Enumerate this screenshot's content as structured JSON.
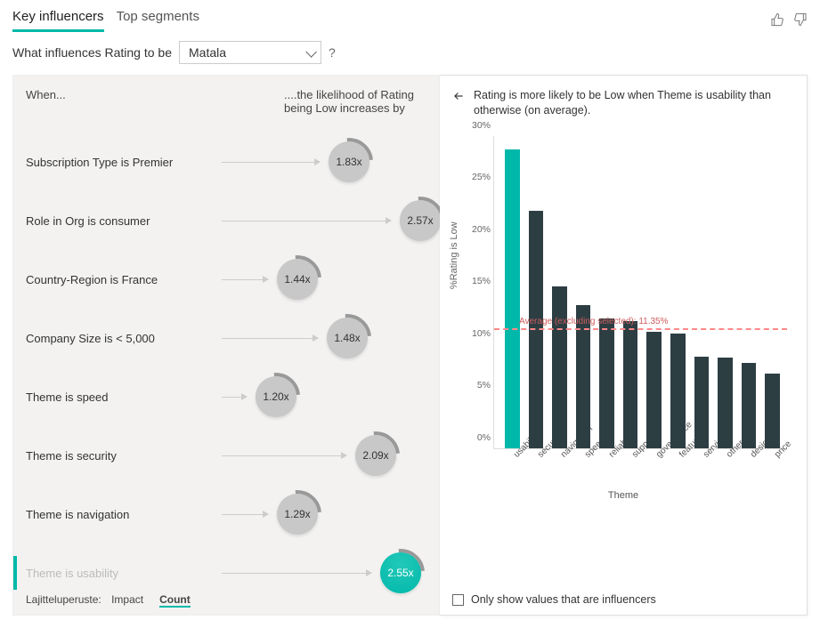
{
  "tabs": {
    "key_influencers": "Key influencers",
    "top_segments": "Top segments"
  },
  "question": {
    "prefix": "What influences Rating to be",
    "value": "Matala",
    "help": "?"
  },
  "left": {
    "when": "When...",
    "likelihood": "....the likelihood of Rating being Low increases by",
    "sort_label": "Lajitteluperuste:",
    "sort_impact": "Impact",
    "sort_count": "Count",
    "influencers": [
      {
        "label": "Subscription Type is Premier",
        "value": "1.83x",
        "pos": 120,
        "selected": false
      },
      {
        "label": "Role in Org is consumer",
        "value": "2.57x",
        "pos": 200,
        "selected": false
      },
      {
        "label": "Country-Region is France",
        "value": "1.44x",
        "pos": 62,
        "selected": false
      },
      {
        "label": "Company Size is < 5,000",
        "value": "1.48x",
        "pos": 118,
        "selected": false
      },
      {
        "label": "Theme is speed",
        "value": "1.20x",
        "pos": 38,
        "selected": false
      },
      {
        "label": "Theme is security",
        "value": "2.09x",
        "pos": 150,
        "selected": false
      },
      {
        "label": "Theme is navigation",
        "value": "1.29x",
        "pos": 62,
        "selected": false
      },
      {
        "label": "Theme is usability",
        "value": "2.55x",
        "pos": 178,
        "selected": true
      }
    ]
  },
  "right": {
    "title": "Rating is more likely to be Low when Theme is usability than otherwise (on average).",
    "ylabel": "%Rating is Low",
    "xlabel": "Theme",
    "avg_label": "Average (excluding selected): 11.35%",
    "avg_value": 11.35,
    "ymax": 30,
    "only_inf": "Only show values that are influencers"
  },
  "chart_data": {
    "type": "bar",
    "title": "Rating is more likely to be Low when Theme is usability than otherwise (on average).",
    "xlabel": "Theme",
    "ylabel": "%Rating is Low",
    "ylim": [
      0,
      30
    ],
    "categories": [
      "usability",
      "security",
      "navigation",
      "speed",
      "reliability",
      "support",
      "governance",
      "features",
      "services",
      "other",
      "design",
      "price"
    ],
    "values": [
      28.7,
      22.8,
      15.5,
      13.7,
      12.5,
      12.2,
      11.2,
      11.0,
      8.8,
      8.7,
      8.2,
      7.2
    ],
    "selected_index": 0,
    "reference_line": {
      "label": "Average (excluding selected): 11.35%",
      "value": 11.35
    }
  }
}
